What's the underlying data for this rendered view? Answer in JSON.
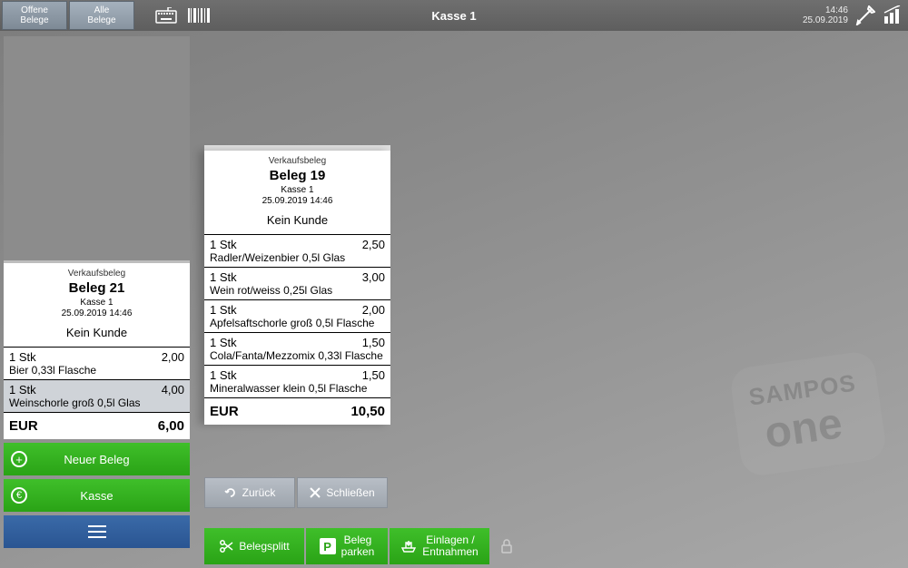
{
  "header": {
    "tab_open": "Offene\nBelege",
    "tab_all": "Alle\nBelege",
    "title": "Kasse 1",
    "time": "14:46",
    "date": "25.09.2019"
  },
  "receipt_active": {
    "type": "Verkaufsbeleg",
    "name": "Beleg 21",
    "register": "Kasse 1",
    "datetime": "25.09.2019 14:46",
    "customer": "Kein Kunde",
    "lines": [
      {
        "qty": "1 Stk",
        "price": "2,00",
        "desc": "Bier 0,33l Flasche",
        "selected": false
      },
      {
        "qty": "1 Stk",
        "price": "4,00",
        "desc": "Weinschorle groß 0,5l Glas",
        "selected": true
      }
    ],
    "currency": "EUR",
    "total": "6,00"
  },
  "receipt_preview": {
    "type": "Verkaufsbeleg",
    "name": "Beleg 19",
    "register": "Kasse 1",
    "datetime": "25.09.2019 14:46",
    "customer": "Kein Kunde",
    "lines": [
      {
        "qty": "1 Stk",
        "price": "2,50",
        "desc": "Radler/Weizenbier 0,5l Glas"
      },
      {
        "qty": "1 Stk",
        "price": "3,00",
        "desc": "Wein rot/weiss 0,25l Glas"
      },
      {
        "qty": "1 Stk",
        "price": "2,00",
        "desc": "Apfelsaftschorle groß 0,5l Flasche"
      },
      {
        "qty": "1 Stk",
        "price": "1,50",
        "desc": "Cola/Fanta/Mezzomix 0,33l Flasche"
      },
      {
        "qty": "1 Stk",
        "price": "1,50",
        "desc": "Mineralwasser klein 0,5l Flasche"
      }
    ],
    "currency": "EUR",
    "total": "10,50"
  },
  "buttons": {
    "new_receipt": "Neuer Beleg",
    "checkout": "Kasse",
    "back": "Zurück",
    "close": "Schließen",
    "split": "Belegsplitt",
    "park": "Beleg\nparken",
    "cash_inout": "Einlagen /\nEntnahmen"
  },
  "watermark": {
    "line1": "SAMPOS",
    "line2": "one"
  }
}
